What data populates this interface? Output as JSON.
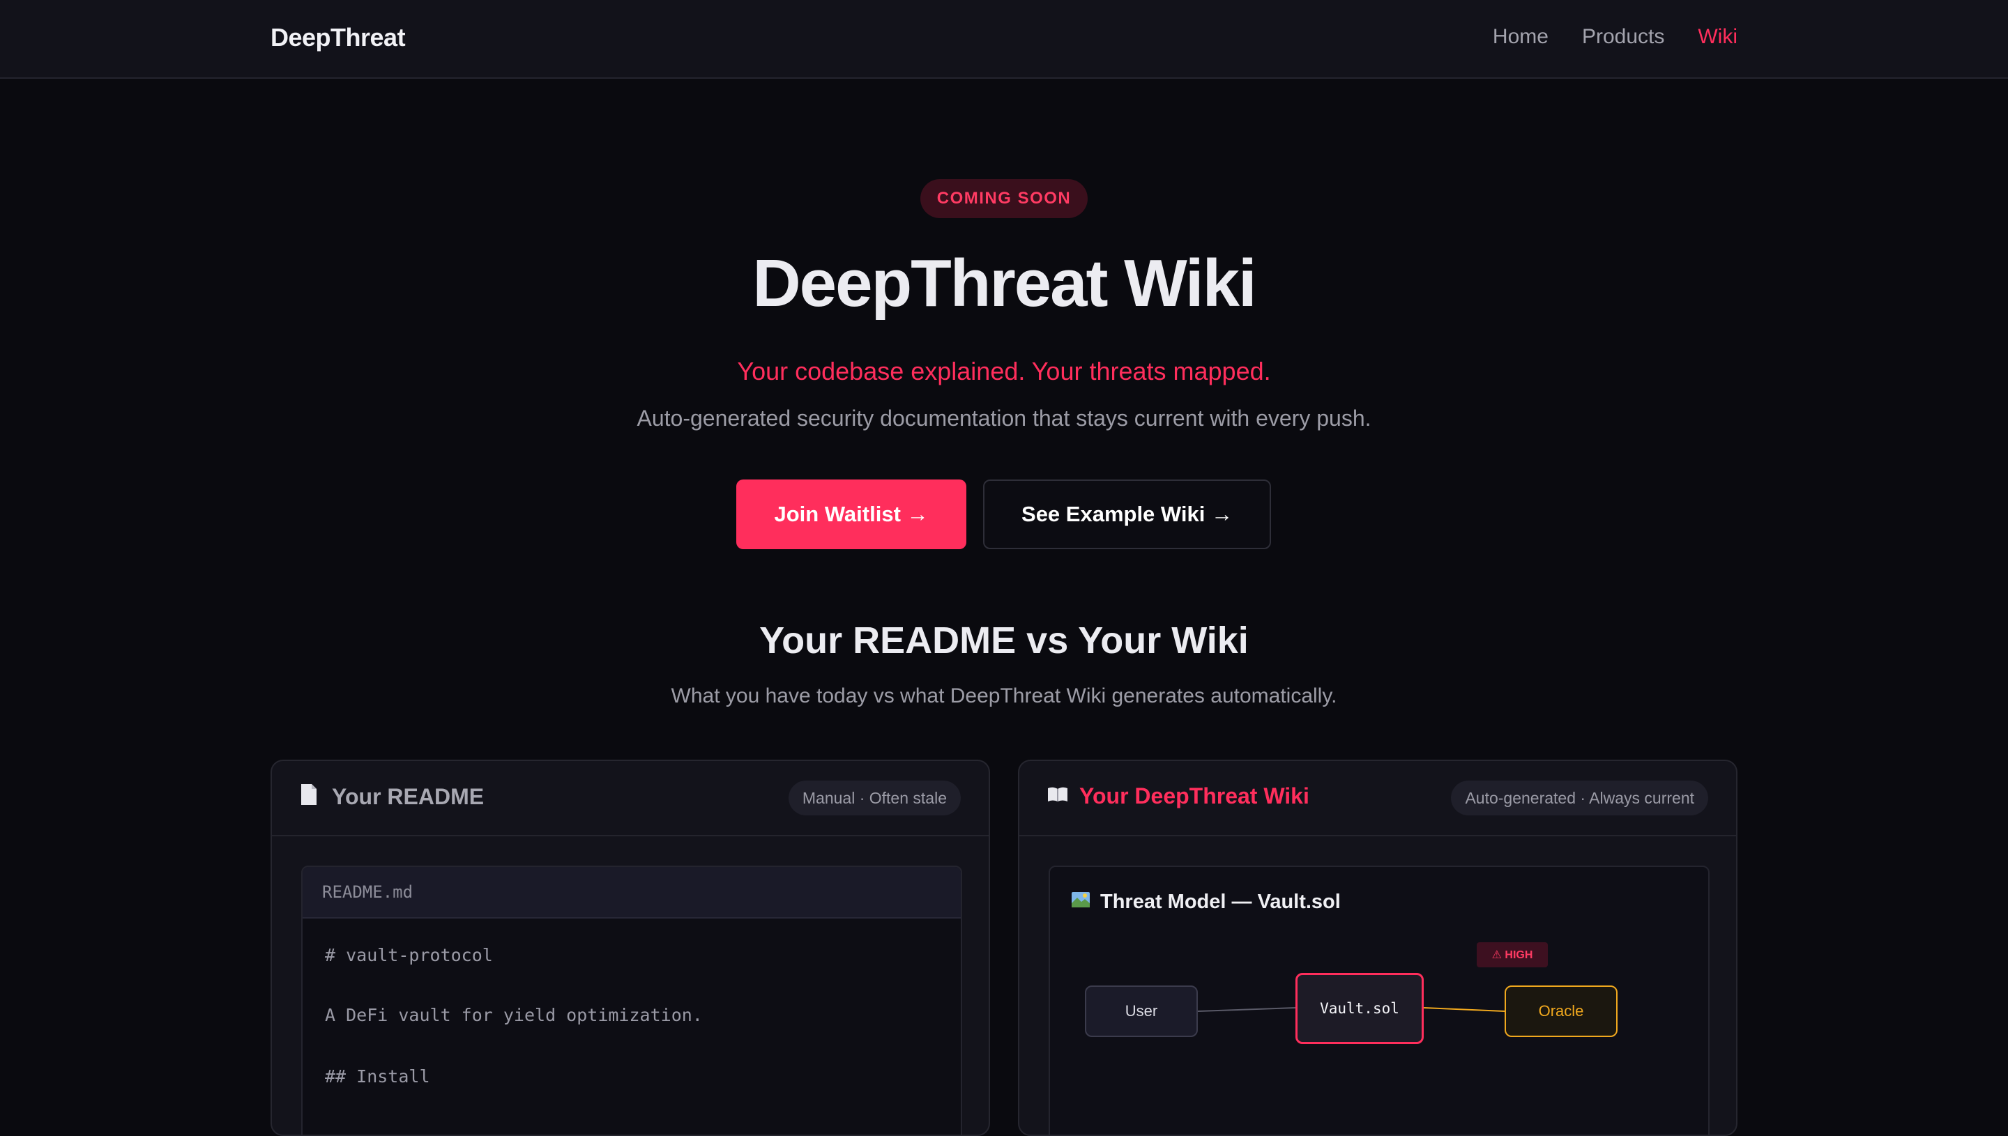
{
  "nav": {
    "brand": "DeepThreat",
    "links": [
      {
        "label": "Home"
      },
      {
        "label": "Products"
      },
      {
        "label": "Wiki",
        "active": true
      }
    ]
  },
  "hero": {
    "badge": "COMING SOON",
    "title": "DeepThreat Wiki",
    "tagline": "Your codebase explained. Your threats mapped.",
    "subtitle": "Auto-generated security documentation that stays current with every push.",
    "primary_button": "Join Waitlist →",
    "secondary_button": "See Example Wiki →"
  },
  "comparison": {
    "title": "Your README vs Your Wiki",
    "subtitle": "What you have today vs what DeepThreat Wiki generates automatically."
  },
  "readme_card": {
    "icon": "document-icon",
    "title": "Your README",
    "pill": "Manual · Often stale",
    "filename": "README.md",
    "lines": [
      "# vault-protocol",
      "A DeFi vault for yield optimization.",
      "## Install"
    ]
  },
  "wiki_card": {
    "icon": "book-icon",
    "title": "Your DeepThreat Wiki",
    "pill": "Auto-generated · Always current",
    "threat_model": {
      "icon": "map-icon",
      "title": "Threat Model — Vault.sol",
      "nodes": {
        "user": "User",
        "vault": "Vault.sol",
        "oracle": "Oracle"
      },
      "severity_badge": "⚠ HIGH"
    }
  },
  "colors": {
    "accent": "#ff2e5c",
    "warning": "#f0a81e",
    "background": "#0a0a0f"
  }
}
